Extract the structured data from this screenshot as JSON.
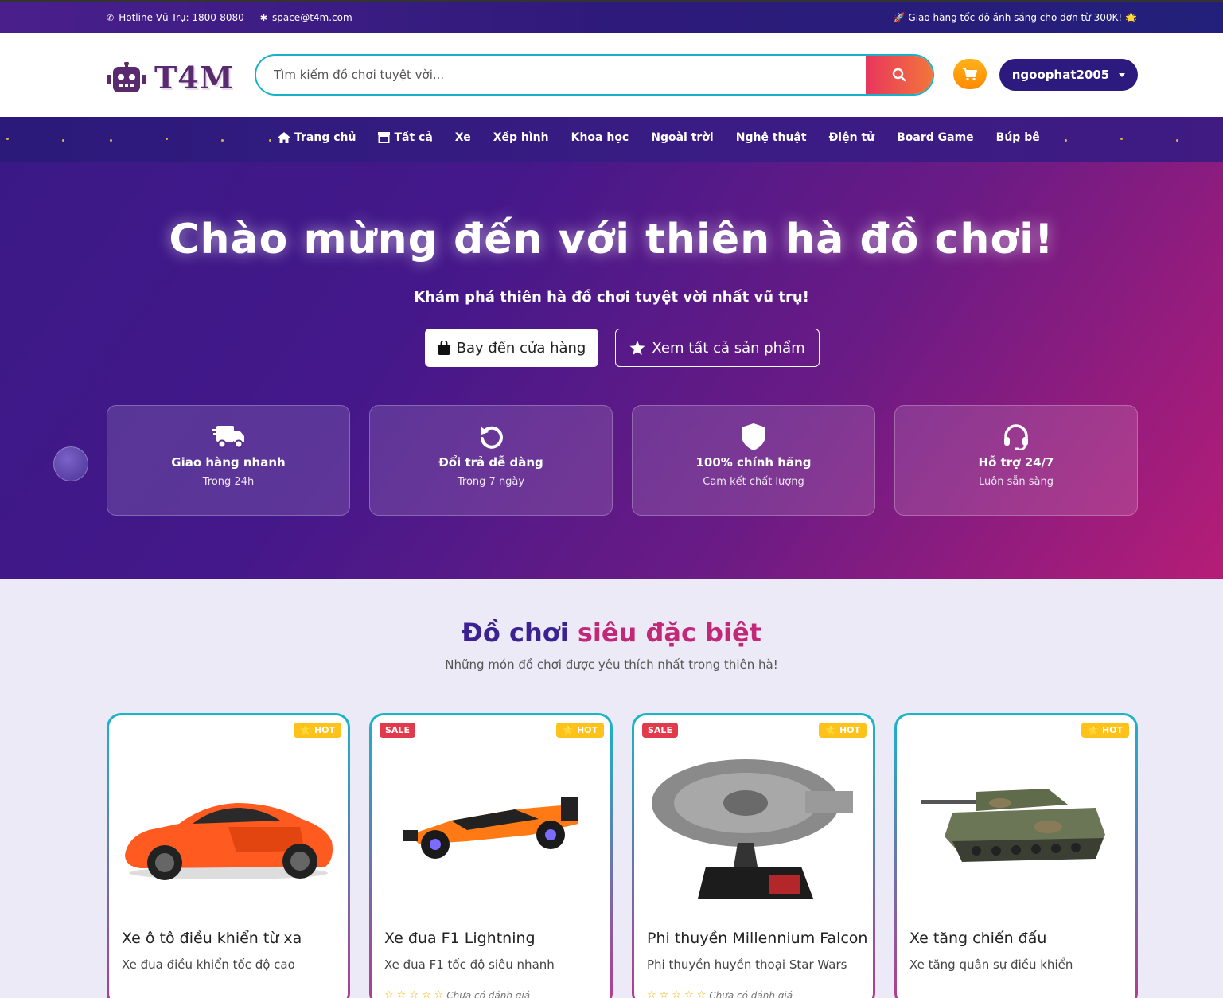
{
  "topbar": {
    "hotline": "Hotline Vũ Trụ: 1800-8080",
    "email": "space@t4m.com",
    "promo": "🚀 Giao hàng tốc độ ánh sáng cho đơn từ 300K! 🌟"
  },
  "header": {
    "logo_text": "T4M",
    "search_placeholder": "Tìm kiếm đồ chơi tuyệt vời...",
    "username": "ngoophat2005"
  },
  "nav": {
    "items": [
      {
        "label": "Trang chủ",
        "icon": "home-icon"
      },
      {
        "label": "Tất cả",
        "icon": "store-icon"
      },
      {
        "label": "Xe"
      },
      {
        "label": "Xếp hình"
      },
      {
        "label": "Khoa học"
      },
      {
        "label": "Ngoài trời"
      },
      {
        "label": "Nghệ thuật"
      },
      {
        "label": "Điện tử"
      },
      {
        "label": "Board Game"
      },
      {
        "label": "Búp bê"
      }
    ]
  },
  "hero": {
    "title": "Chào mừng đến với thiên hà đồ chơi!",
    "subtitle": "Khám phá thiên hà đồ chơi tuyệt vời nhất vũ trụ!",
    "btn_shop": "Bay đến cửa hàng",
    "btn_all": "Xem tất cả sản phẩm",
    "features": [
      {
        "title": "Giao hàng nhanh",
        "sub": "Trong 24h",
        "icon": "truck-icon"
      },
      {
        "title": "Đổi trả dễ dàng",
        "sub": "Trong 7 ngày",
        "icon": "return-icon"
      },
      {
        "title": "100% chính hãng",
        "sub": "Cam kết chất lượng",
        "icon": "shield-icon"
      },
      {
        "title": "Hỗ trợ 24/7",
        "sub": "Luôn sẵn sàng",
        "icon": "headset-icon"
      }
    ]
  },
  "section": {
    "title_a": "Đồ chơi",
    "title_b": "siêu đặc biệt",
    "subtitle": "Những món đồ chơi được yêu thích nhất trong thiên hà!"
  },
  "products": [
    {
      "name": "Xe ô tô điều khiển từ xa",
      "desc": "Xe đua điều khiển tốc độ cao",
      "sale": "",
      "hot": "HOT",
      "rating": ""
    },
    {
      "name": "Xe đua F1 Lightning",
      "desc": "Xe đua F1 tốc độ siêu nhanh",
      "sale": "SALE",
      "hot": "HOT",
      "rating": "Chưa có đánh giá"
    },
    {
      "name": "Phi thuyền Millennium Falcon",
      "desc": "Phi thuyền huyền thoại Star Wars",
      "sale": "SALE",
      "hot": "HOT",
      "rating": "Chưa có đánh giá"
    },
    {
      "name": "Xe tăng chiến đấu",
      "desc": "Xe tăng quân sự điều khiển",
      "sale": "",
      "hot": "HOT",
      "rating": ""
    }
  ],
  "colors": {
    "brand_purple": "#2d1a7e",
    "accent_pink": "#c22878",
    "accent_teal": "#16b3c8",
    "sale_red": "#e03a4c",
    "hot_yellow": "#ffc21a"
  }
}
